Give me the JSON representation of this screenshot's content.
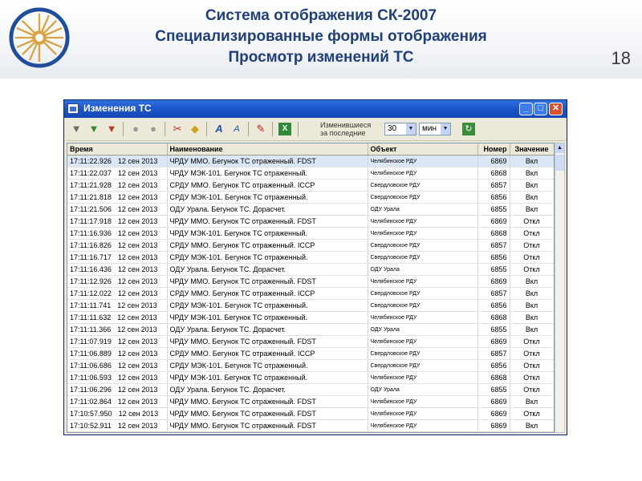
{
  "slide": {
    "title_line1": "Система отображения СК-2007",
    "title_line2": "Специализированные формы отображения",
    "title_line3": "Просмотр изменений ТС",
    "page_number": "18",
    "accent_color": "#1f3f7f"
  },
  "window": {
    "title": "Изменения ТС",
    "buttons": {
      "minimize": "_",
      "maximize": "□",
      "close": "✕"
    }
  },
  "toolbar": {
    "icons": [
      "filter-icon",
      "filter-apply-icon",
      "filter-clear-icon",
      "object-icon",
      "object-group-icon",
      "cut-icon",
      "paint-icon",
      "font-icon",
      "font-small-icon",
      "pin-icon",
      "excel-icon",
      "refresh-icon"
    ],
    "period_label_line1": "Изменившиеся",
    "period_label_line2": "за последние",
    "period_value": "30",
    "period_unit": "мин"
  },
  "table": {
    "columns": [
      "Время",
      "Наименование",
      "Объект",
      "Номер",
      "Значение"
    ],
    "rows": [
      [
        "17:11:22.926",
        "12 сен 2013",
        "ЧРДУ ММО. Бегунок ТС отраженный. FDST",
        "Челябинское РДУ",
        "6869",
        "Вкл"
      ],
      [
        "17:11:22.037",
        "12 сен 2013",
        "ЧРДУ МЭК-101. Бегунок ТС отраженный.",
        "Челябинское РДУ",
        "6868",
        "Вкл"
      ],
      [
        "17:11:21.928",
        "12 сен 2013",
        "СРДУ ММО. Бегунок ТС отраженный. ICCP",
        "Свердловское РДУ",
        "6857",
        "Вкл"
      ],
      [
        "17:11:21.818",
        "12 сен 2013",
        "СРДУ МЭК-101. Бегунок ТС отраженный.",
        "Свердловское РДУ",
        "6856",
        "Вкл"
      ],
      [
        "17:11:21.506",
        "12 сен 2013",
        "ОДУ Урала. Бегунок ТС. Дорасчет.",
        "ОДУ Урала",
        "6855",
        "Вкл"
      ],
      [
        "17:11:17.918",
        "12 сен 2013",
        "ЧРДУ ММО. Бегунок ТС отраженный. FDST",
        "Челябинское РДУ",
        "6869",
        "Откл"
      ],
      [
        "17:11:16.936",
        "12 сен 2013",
        "ЧРДУ МЭК-101. Бегунок ТС отраженный.",
        "Челябинское РДУ",
        "6868",
        "Откл"
      ],
      [
        "17:11:16.826",
        "12 сен 2013",
        "СРДУ ММО. Бегунок ТС отраженный. ICCP",
        "Свердловское РДУ",
        "6857",
        "Откл"
      ],
      [
        "17:11:16.717",
        "12 сен 2013",
        "СРДУ МЭК-101. Бегунок ТС отраженный.",
        "Свердловское РДУ",
        "6856",
        "Откл"
      ],
      [
        "17:11:16.436",
        "12 сен 2013",
        "ОДУ Урала. Бегунок ТС. Дорасчет.",
        "ОДУ Урала",
        "6855",
        "Откл"
      ],
      [
        "17:11:12.926",
        "12 сен 2013",
        "ЧРДУ ММО. Бегунок ТС отраженный. FDST",
        "Челябинское РДУ",
        "6869",
        "Вкл"
      ],
      [
        "17:11:12.022",
        "12 сен 2013",
        "СРДУ ММО. Бегунок ТС отраженный. ICCP",
        "Свердловское РДУ",
        "6857",
        "Вкл"
      ],
      [
        "17:11:11.741",
        "12 сен 2013",
        "СРДУ МЭК-101. Бегунок ТС отраженный.",
        "Свердловское РДУ",
        "6856",
        "Вкл"
      ],
      [
        "17:11:11.632",
        "12 сен 2013",
        "ЧРДУ МЭК-101. Бегунок ТС отраженный.",
        "Челябинское РДУ",
        "6868",
        "Вкл"
      ],
      [
        "17:11:11.366",
        "12 сен 2013",
        "ОДУ Урала. Бегунок ТС. Дорасчет.",
        "ОДУ Урала",
        "6855",
        "Вкл"
      ],
      [
        "17:11:07.919",
        "12 сен 2013",
        "ЧРДУ ММО. Бегунок ТС отраженный. FDST",
        "Челябинское РДУ",
        "6869",
        "Откл"
      ],
      [
        "17:11:06.889",
        "12 сен 2013",
        "СРДУ ММО. Бегунок ТС отраженный. ICCP",
        "Свердловское РДУ",
        "6857",
        "Откл"
      ],
      [
        "17:11:06.686",
        "12 сен 2013",
        "СРДУ МЭК-101. Бегунок ТС отраженный.",
        "Свердловское РДУ",
        "6856",
        "Откл"
      ],
      [
        "17:11:06.593",
        "12 сен 2013",
        "ЧРДУ МЭК-101. Бегунок ТС отраженный.",
        "Челябинское РДУ",
        "6868",
        "Откл"
      ],
      [
        "17:11:06.296",
        "12 сен 2013",
        "ОДУ Урала. Бегунок ТС. Дорасчет.",
        "ОДУ Урала",
        "6855",
        "Откл"
      ],
      [
        "17:11:02.864",
        "12 сен 2013",
        "ЧРДУ ММО. Бегунок ТС отраженный. FDST",
        "Челябинское РДУ",
        "6869",
        "Вкл"
      ],
      [
        "17:10:57.950",
        "12 сен 2013",
        "ЧРДУ ММО. Бегунок ТС отраженный. FDST",
        "Челябинское РДУ",
        "6869",
        "Откл"
      ],
      [
        "17:10:52.911",
        "12 сен 2013",
        "ЧРДУ ММО. Бегунок ТС отраженный. FDST",
        "Челябинское РДУ",
        "6869",
        "Вкл"
      ]
    ]
  }
}
